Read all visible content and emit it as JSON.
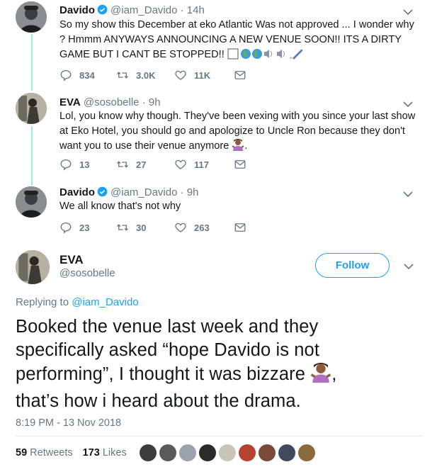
{
  "tweets": [
    {
      "name": "Davido",
      "handle": "@iam_Davido",
      "time": "· 14h",
      "text": "So my show this December at eko Atlantic Was not approved ... I wonder why ? Hmmm ANYWAYS ANNOUNCING A NEW VENUE SOON!! ITS A DIRTY GAME BUT I CANT BE STOPPED!!",
      "replies": "834",
      "retweets": "3.0K",
      "likes": "11K"
    },
    {
      "name": "EVA",
      "handle": "@sosobelle",
      "time": "· 9h",
      "text": "Lol, you know why though. They've been vexing with you since your last show at Eko Hotel, you should go and apologize to Uncle Ron because they don't want you to use their venue anymore",
      "replies": "13",
      "retweets": "27",
      "likes": "117"
    },
    {
      "name": "Davido",
      "handle": "@iam_Davido",
      "time": "· 9h",
      "text": "We all know that's not why",
      "replies": "23",
      "retweets": "30",
      "likes": "263"
    }
  ],
  "main_tweet": {
    "name": "EVA",
    "handle": "@sosobelle",
    "follow_label": "Follow",
    "replying_prefix": "Replying to",
    "replying_handle": "@iam_Davido",
    "text_line1": "Booked the venue last week and they",
    "text_line2": "specifically asked “hope Davido is not",
    "text_line3": "performing”, I thought it was bizzare",
    "text_line3_after": ",",
    "text_line4": "that’s how i heard about the drama.",
    "timestamp": "8:19 PM - 13 Nov 2018",
    "retweet_count": "59",
    "retweet_label": "Retweets",
    "like_count": "173",
    "like_label": "Likes"
  },
  "colors": {
    "accent": "#1da1f2",
    "thread_line": "#9fe6ef",
    "secondary_text": "#657786",
    "text": "#14171a"
  },
  "icons": [
    "reply-icon",
    "retweet-icon",
    "like-icon",
    "message-icon",
    "verified-badge-icon",
    "chevron-down-icon"
  ]
}
